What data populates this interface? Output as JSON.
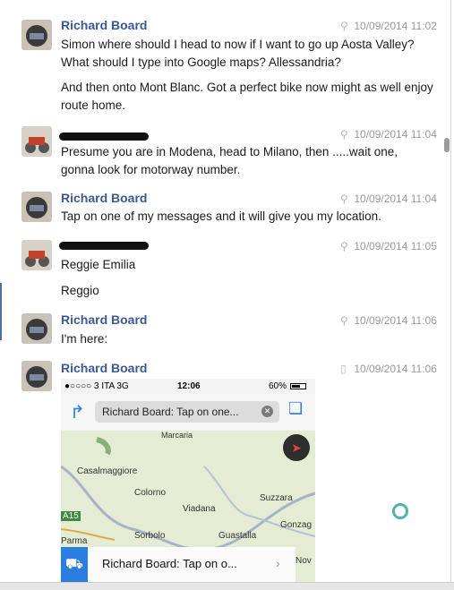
{
  "messages": [
    {
      "sender": "Richard Board",
      "timestamp": "10/09/2014 11:02",
      "lines": [
        "Simon where should I head to now if I want to go up Aosta Valley? What should I type into Google maps?  Allessandria?",
        "And then onto Mont Blanc. Got a perfect bike now might as well enjoy route home."
      ]
    },
    {
      "sender": "",
      "timestamp": "10/09/2014 11:04",
      "lines": [
        "Presume you are in Modena, head to Milano, then .....wait one, gonna look for motorway number."
      ]
    },
    {
      "sender": "Richard Board",
      "timestamp": "10/09/2014 11:04",
      "lines": [
        "Tap on one of my messages and it will give you my location."
      ]
    },
    {
      "sender": "",
      "timestamp": "10/09/2014 11:05",
      "lines": [
        "Reggie Emilia",
        "Reggio"
      ]
    },
    {
      "sender": "Richard Board",
      "timestamp": "10/09/2014 11:06",
      "lines": [
        "I'm here:"
      ]
    },
    {
      "sender": "Richard Board",
      "timestamp": "10/09/2014 11:06",
      "lines": []
    }
  ],
  "phone": {
    "carrier": "●○○○○ 3 ITA  3G",
    "time": "12:06",
    "battery": "60%",
    "url_text": "Richard Board: Tap on one...",
    "map_labels": [
      "Marcaria",
      "Casalmaggiore",
      "Colorno",
      "Viadana",
      "Suzzara",
      "Gonzag",
      "A15",
      "Parma",
      "Sorbolo",
      "Guastalla",
      "Nov"
    ],
    "card_text": "Richard Board: Tap on o..."
  },
  "icons": {
    "location": "location-pin-icon",
    "device": "mobile-device-icon",
    "compass": "compass-icon",
    "car": "car-icon",
    "book": "book-icon",
    "back": "share-arrow-icon"
  }
}
